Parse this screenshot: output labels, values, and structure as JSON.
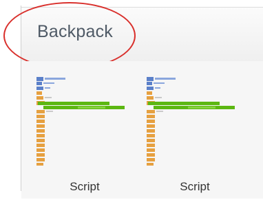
{
  "backpack": {
    "title": "Backpack",
    "items": [
      {
        "label": "Script"
      },
      {
        "label": "Script"
      }
    ]
  },
  "colors": {
    "highlight_circle": "#d9302c",
    "block_blue": "#5b80c9",
    "block_orange": "#e6a040",
    "block_green": "#5cb712"
  }
}
